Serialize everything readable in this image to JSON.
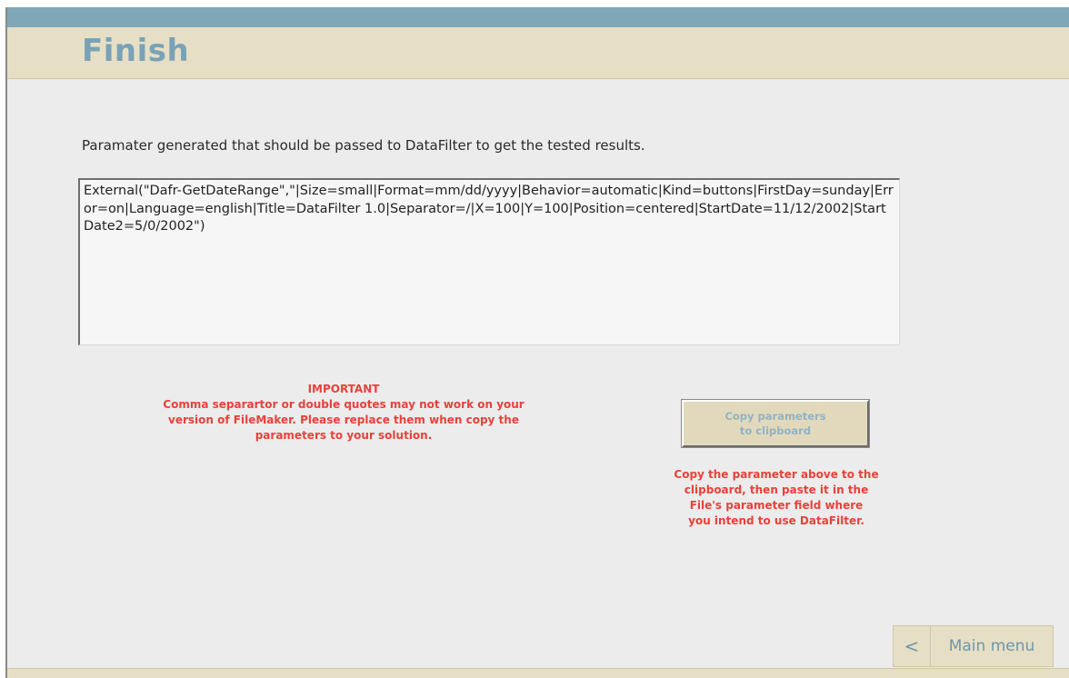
{
  "header": {
    "title": "Finish"
  },
  "main": {
    "description": "Paramater generated that should be passed to DataFilter to get the tested results.",
    "parameter_text": "External(\"Dafr-GetDateRange\",\"|Size=small|Format=mm/dd/yyyy|Behavior=automatic|Kind=buttons|FirstDay=sunday|Error=on|Language=english|Title=DataFilter 1.0|Separator=/|X=100|Y=100|Position=centered|StartDate=11/12/2002|StartDate2=5/0/2002\")",
    "important": {
      "heading": "IMPORTANT",
      "line1": "Comma separartor or double quotes may not work on your",
      "line2": "version of FileMaker. Please replace them when copy the",
      "line3": "parameters to your solution."
    },
    "copy_button": {
      "line1": "Copy parameters",
      "line2": "to clipboard"
    },
    "copy_note": {
      "line1": "Copy the parameter above to the",
      "line2": "clipboard, then paste it in the",
      "line3": "File's parameter field where",
      "line4": "you intend to use DataFilter."
    }
  },
  "footer": {
    "back_glyph": "<",
    "main_menu_label": "Main menu"
  },
  "colors": {
    "title": "#7aa2b6",
    "warning": "#e8413a",
    "header_band": "#e6dfc6",
    "top_strip": "#7fa7b8"
  },
  "icons": {
    "back": "chevron-left-icon"
  }
}
